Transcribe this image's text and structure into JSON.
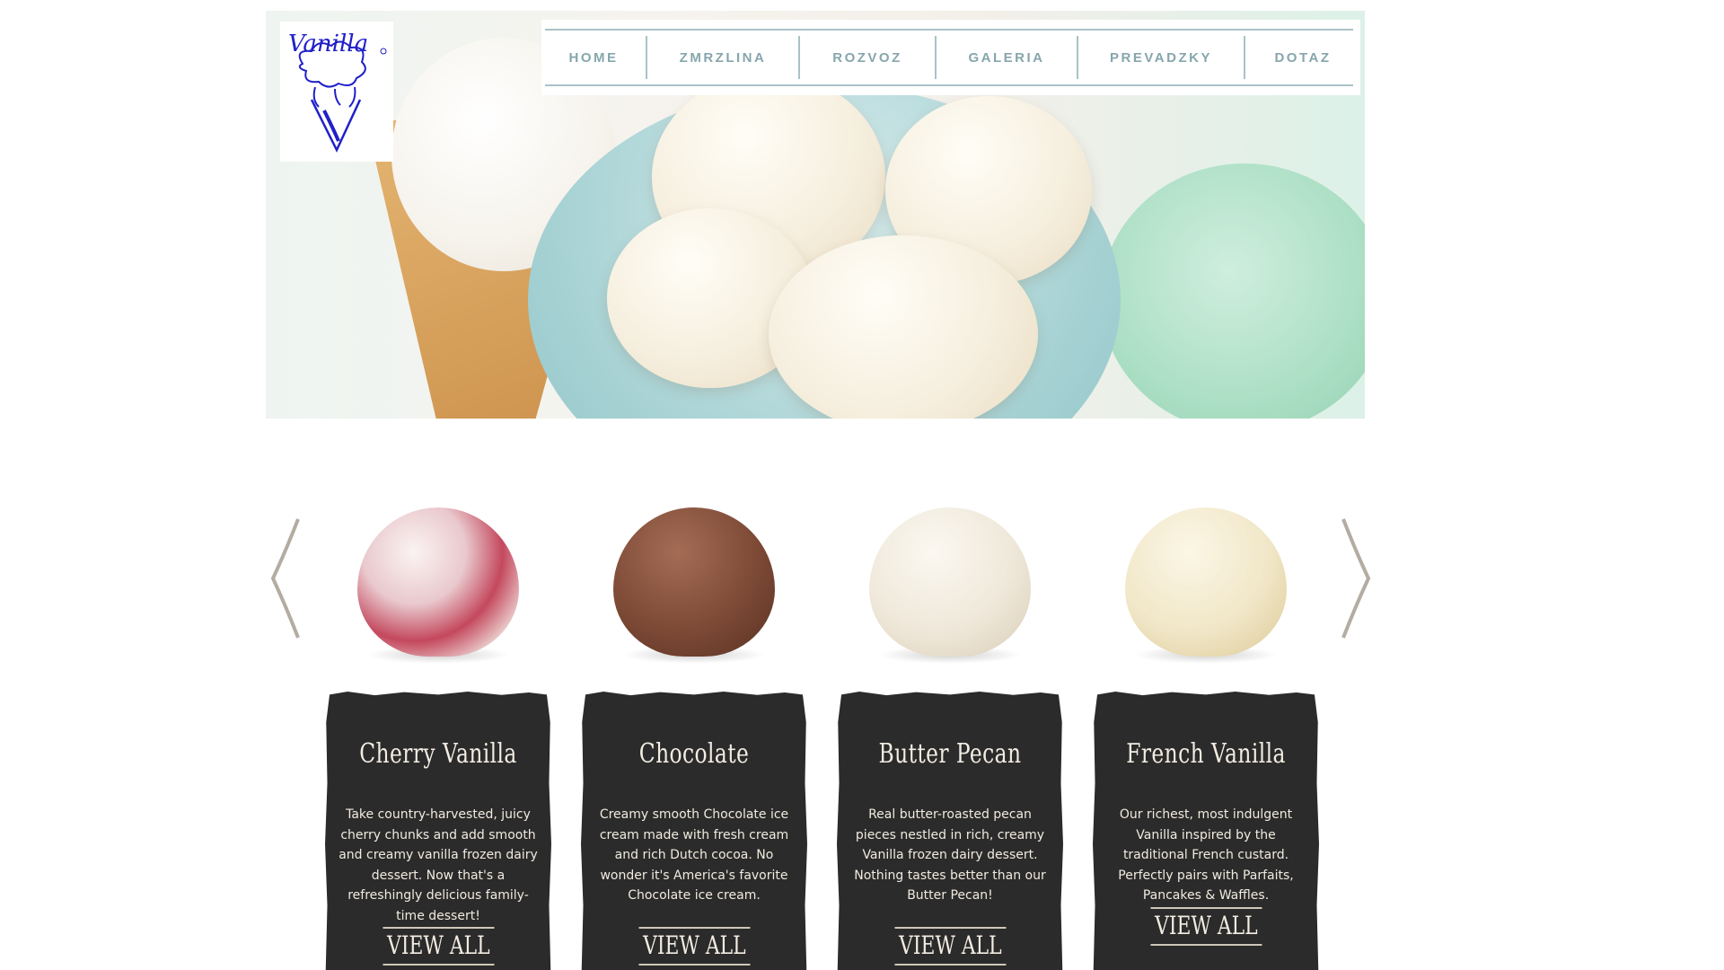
{
  "logo": {
    "text": "Vanilla"
  },
  "nav": {
    "items": [
      {
        "label": "HOME"
      },
      {
        "label": "ZMRZLINA"
      },
      {
        "label": "ROZVOZ"
      },
      {
        "label": "GALERIA"
      },
      {
        "label": "PREVADZKY"
      },
      {
        "label": "DOTAZ"
      }
    ]
  },
  "colors": {
    "nav_text": "#86a6ac",
    "nav_rule": "#a9c2c6",
    "panel_bg": "#2b2b2b",
    "panel_text": "#f2ece2",
    "arrow": "#b4aca2",
    "logo_ink": "#2020c8"
  },
  "carousel": {
    "prev_icon": "chevron-left-icon",
    "next_icon": "chevron-right-icon",
    "flavors": [
      {
        "title": "Cherry Vanilla",
        "description": "Take country-harvested, juicy cherry chunks and add smooth and creamy vanilla frozen dairy dessert. Now that's a refreshingly delicious family-time dessert!",
        "cta": "VIEW ALL",
        "image": "cherry-vanilla-scoop",
        "color": "#e9c9cd"
      },
      {
        "title": "Chocolate",
        "description": "Creamy smooth Chocolate ice cream made with fresh cream and rich Dutch cocoa. No wonder it's America's favorite Chocolate ice cream.",
        "cta": "VIEW ALL",
        "image": "chocolate-scoop",
        "color": "#7d4a36"
      },
      {
        "title": "Butter Pecan",
        "description": "Real butter-roasted pecan pieces nestled in rich, creamy Vanilla frozen dairy dessert. Nothing tastes better than our Butter Pecan!",
        "cta": "VIEW ALL",
        "image": "butter-pecan-scoop",
        "color": "#efe8da"
      },
      {
        "title": "French Vanilla",
        "description": "Our richest, most indulgent Vanilla inspired by the traditional French custard. Perfectly pairs with Parfaits, Pancakes & Waffles.",
        "cta": "VIEW ALL",
        "image": "french-vanilla-scoop",
        "color": "#f1e7c8"
      }
    ]
  }
}
